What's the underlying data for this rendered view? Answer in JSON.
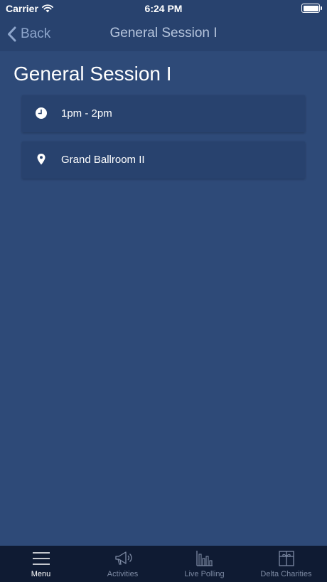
{
  "status_bar": {
    "carrier": "Carrier",
    "time": "6:24 PM",
    "battery_level": 1.0
  },
  "nav": {
    "back_label": "Back",
    "title": "General Session I"
  },
  "session": {
    "title": "General Session I",
    "time": "1pm - 2pm",
    "location": "Grand Ballroom II"
  },
  "tab_bar": {
    "active": "Menu",
    "tabs": [
      {
        "label": "Menu",
        "icon": "menu-icon"
      },
      {
        "label": "Activities",
        "icon": "megaphone-icon"
      },
      {
        "label": "Live Polling",
        "icon": "bar-chart-icon"
      },
      {
        "label": "Delta Charities",
        "icon": "gift-icon"
      }
    ]
  },
  "colors": {
    "background": "#2e4a78",
    "nav_background": "#28426e",
    "card_background": "#28426e",
    "tab_bar_background": "#0f1b33",
    "tab_inactive": "#7d8aa3",
    "back_text": "#8ea6cc"
  }
}
